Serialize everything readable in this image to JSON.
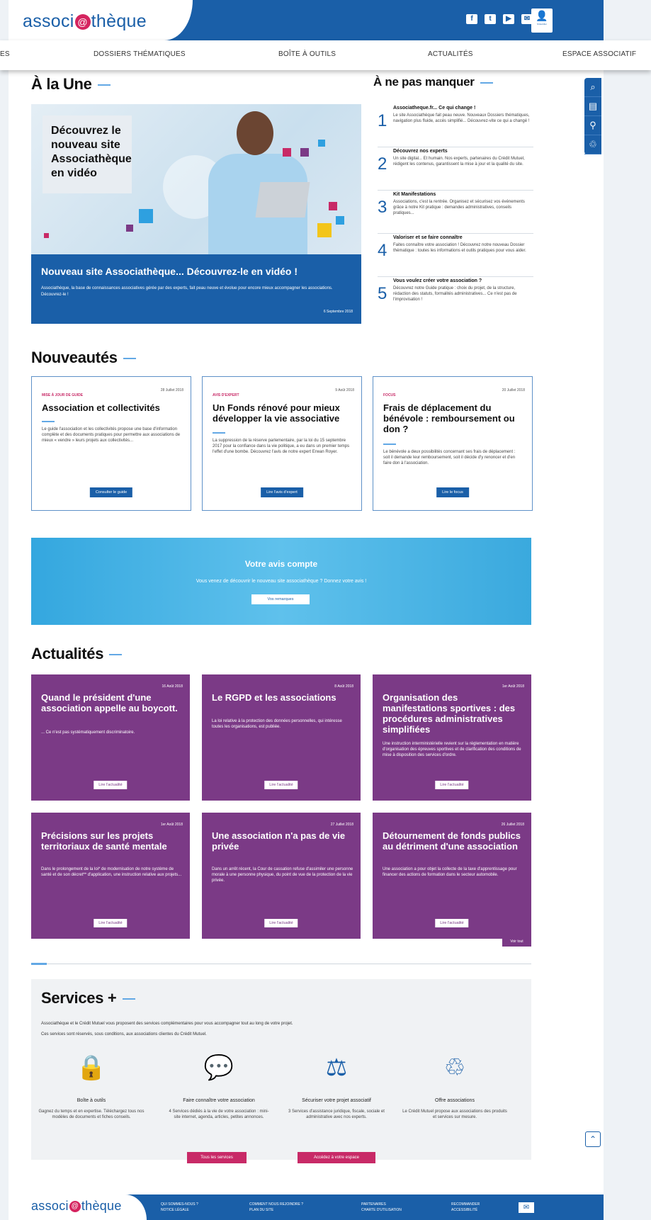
{
  "header": {
    "logo": {
      "pre": "associ",
      "mark": "@",
      "post": "thèque"
    },
    "social": [
      "f",
      "t",
      "▶",
      "✉"
    ],
    "user_label": "S'identifier"
  },
  "nav": {
    "items": [
      "ES",
      "DOSSIERS THÉMATIQUES",
      "BOÎTE À OUTILS",
      "ACTUALITÉS",
      "ESPACE ASSOCIATIF"
    ]
  },
  "tools": [
    "⌕",
    "▤",
    "⚲",
    "♲"
  ],
  "une": {
    "title": "À la Une",
    "hero_box": "Découvrez le nouveau site Associathèque en vidéo",
    "caption_title": "Nouveau site Associathèque... Découvrez-le en vidéo !",
    "caption_text": "Associathèque, la base de connaissances associatives gérée par des experts, fait peau neuve et évolue pour encore mieux accompagner les associations. Découvrez-le !",
    "caption_date": "6 Septembre 2018"
  },
  "miss": {
    "title": "À ne pas manquer",
    "items": [
      {
        "n": "1",
        "t": "Associatheque.fr... Ce qui change !",
        "d": "Le site Associathèque fait peau neuve. Nouveaux Dossiers thématiques, navigation plus fluide, accès simplifié... Découvrez-vite ce qui a changé !"
      },
      {
        "n": "2",
        "t": "Découvrez nos experts",
        "d": "Un site digital... Et humain. Nos experts, partenaires du Crédit Mutuel, rédigent les contenus, garantissent la mise à jour et la qualité du site."
      },
      {
        "n": "3",
        "t": "Kit Manifestations",
        "d": "Associations, c'est la rentrée. Organisez et sécurisez vos événements grâce à notre Kit pratique : demandes administratives, conseils pratiques..."
      },
      {
        "n": "4",
        "t": "Valoriser et se faire connaître",
        "d": "Faites connaître votre association ! Découvrez notre nouveau Dossier thématique : toutes les informations et outils pratiques pour vous aider."
      },
      {
        "n": "5",
        "t": "Vous voulez créer votre association ?",
        "d": "Découvrez notre Guide pratique : choix du projet, de la structure, rédaction des statuts, formalités administratives... Ce n'est pas de l'improvisation !"
      }
    ]
  },
  "news": {
    "title": "Nouveautés",
    "cards": [
      {
        "cat": "MISE À JOUR DE GUIDE",
        "date": "28 Juillet 2018",
        "h": "Association et collectivités",
        "p": "Le guide l'association et les collectivités propose une base d'information complète et des documents pratiques pour permettre aux associations de mieux « vendre » leurs projets aux collectivités...",
        "btn": "Consulter le guide"
      },
      {
        "cat": "AVIS D'EXPERT",
        "date": "9 Août 2018",
        "h": "Un Fonds rénové pour mieux développer la vie associative",
        "p": "La suppression de la réserve parlementaire, par la loi du 15 septembre 2017 pour la confiance dans la vie politique, a eu dans un premier temps l'effet d'une bombe. Découvrez l'avis de notre expert Erwan Royer.",
        "btn": "Lire l'avis d'expert"
      },
      {
        "cat": "FOCUS",
        "date": "20 Juillet 2018",
        "h": "Frais de déplacement du bénévole : remboursement ou don ?",
        "p": "Le bénévole a deux possibilités concernant ses frais de déplacement : soit il demande leur remboursement, soit il décide d'y renoncer et d'en faire don à l'association.",
        "btn": "Lire le focus"
      }
    ]
  },
  "banner": {
    "title": "Votre avis compte",
    "text": "Vous venez de découvrir le nouveau site associathèque ? Donnez votre avis !",
    "btn": "Vos remarques"
  },
  "actus": {
    "title": "Actualités",
    "btn": "Lire l'actualité",
    "see_all": "Voir tout",
    "cards": [
      {
        "date": "16 Août 2018",
        "h": "Quand le président d'une association appelle au boycott.",
        "p": "... Ce n'est pas systématiquement discriminatoire."
      },
      {
        "date": "8 Août 2018",
        "h": "Le RGPD et les associations",
        "p": "La loi relative à la protection des données personnelles, qui intéresse toutes les organisations, est publiée."
      },
      {
        "date": "1er Août 2018",
        "h": "Organisation des manifestations sportives : des procédures administratives simplifiées",
        "p": "Une instruction interministérielle revient sur la réglementation en matière d'organisation des épreuves sportives et de clarification des conditions de mise à disposition des services d'ordre."
      },
      {
        "date": "1er Août 2018",
        "h": "Précisions sur les projets territoriaux de santé mentale",
        "p": "Dans le prolongement de la loi* de modernisation de notre système de santé et de son décret** d'application, une instruction relative aux projets..."
      },
      {
        "date": "27 Juillet 2018",
        "h": "Une association n'a pas de vie privée",
        "p": "Dans un arrêt récent, la Cour de cassation refuse d'assimiler une personne morale à une personne physique, du point de vue de la protection de la vie privée."
      },
      {
        "date": "26 Juillet 2018",
        "h": "Détournement de fonds publics au détriment d'une association",
        "p": "Une association a pour objet la collecte de la taxe d'apprentissage pour financer des actions de formation dans le secteur automobile."
      }
    ]
  },
  "services": {
    "title": "Services +",
    "intro1": "Associathèque et le Crédit Mutuel vous proposent des services complémentaires pour vous accompagner tout au long de votre projet.",
    "intro2": "Ces services sont réservés, sous conditions, aux associations clientes du Crédit Mutuel.",
    "items": [
      {
        "icon": "🔒",
        "t": "Boîte à outils",
        "p": "Gagnez du temps et en expertise. Téléchargez tous nos modèles de documents et fiches conseils."
      },
      {
        "icon": "💬",
        "t": "Faire connaître votre association",
        "p": "4 Services dédiés à la vie de votre association : mini-site internet, agenda, articles, petites annonces."
      },
      {
        "icon": "⚖",
        "t": "Sécuriser votre projet associatif",
        "p": "3 Services d'assistance juridique, fiscale, sociale et administrative avec nos experts."
      },
      {
        "icon": "♲",
        "t": "Offre associations",
        "p": "Le Crédit Mutuel propose aux associations des produits et services sur mesure."
      }
    ],
    "btn1": "Tous les services",
    "btn2": "Accédez à votre espace"
  },
  "footer": {
    "links": [
      [
        "QUI SOMMES-NOUS ?",
        "NOTICE LÉGALE"
      ],
      [
        "COMMENT NOUS REJOINDRE ?",
        "PLAN DU SITE"
      ],
      [
        "PARTENAIRES",
        "CHARTE D'UTILISATION"
      ],
      [
        "RECOMMANDER",
        "ACCESSIBILITÉ"
      ]
    ]
  },
  "colors": {
    "primary": "#1a5fa8",
    "accent": "#c82a67",
    "purple": "#7b3a86",
    "sky": "#3aa9de"
  }
}
